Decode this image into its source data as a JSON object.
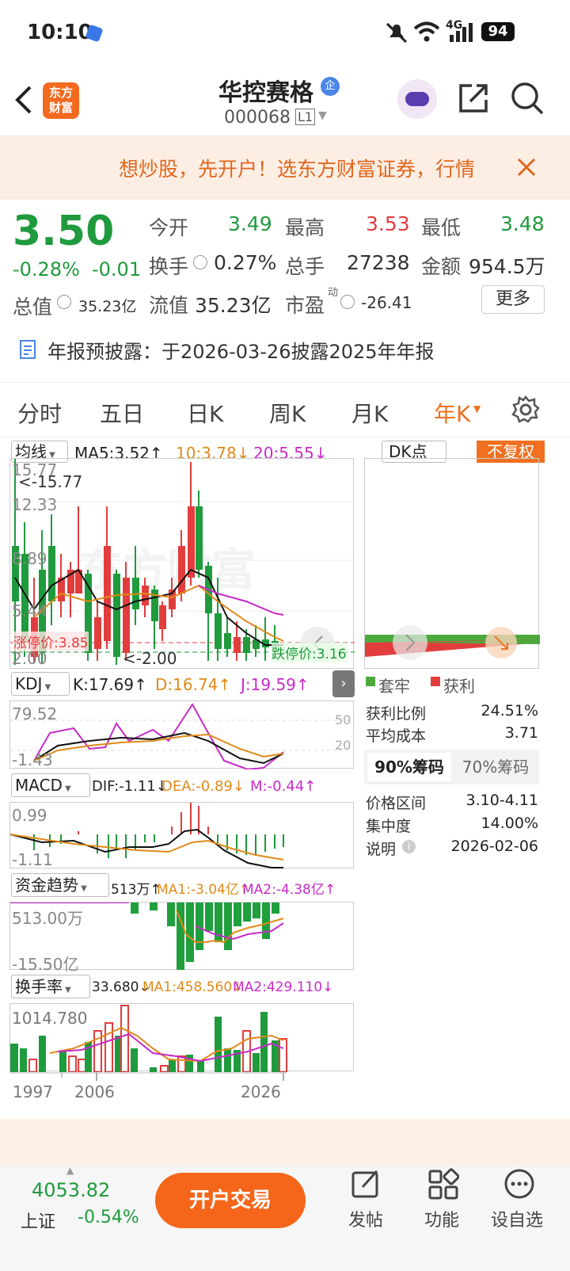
{
  "status": {
    "time": "10:10",
    "battery": "94",
    "net": "4G"
  },
  "nav": {
    "title": "华控赛格",
    "badge": "企",
    "code": "000068",
    "level": "L1",
    "brand": "东方\n财富"
  },
  "banner": {
    "text": "想炒股，先开户！选东方财富证券，行情"
  },
  "quote": {
    "price": "3.50",
    "pct": "-0.28%",
    "chg": "-0.01",
    "open_lbl": "今开",
    "open": "3.49",
    "high_lbl": "最高",
    "high": "3.53",
    "low_lbl": "最低",
    "low": "3.48",
    "turn_lbl": "换手",
    "turn": "0.27%",
    "vol_lbl": "总手",
    "vol": "27238",
    "amt_lbl": "金额",
    "amt": "954.5万",
    "mcap_lbl": "总值",
    "mcap": "35.23亿",
    "float_lbl": "流值",
    "float": "35.23亿",
    "pe_lbl": "市盈",
    "pe_sup": "动",
    "pe": "-26.41",
    "more": "更多"
  },
  "notice": {
    "text": "年报预披露：于2026-03-26披露2025年年报"
  },
  "tabs": [
    "分时",
    "五日",
    "日K",
    "周K",
    "月K",
    "年K"
  ],
  "main": {
    "ma_label": "均线",
    "ma5": "MA5:3.52↑",
    "ma10": "10:3.78↓",
    "ma20": "20:5.55↓",
    "dk": "DK点",
    "fq": "不复权",
    "y1": "15.77",
    "y2": "12.33",
    "y3": "8.89",
    "y4": "5.44",
    "y5": "2.00",
    "maxmark": "<-15.77",
    "minmark": "<-2.00",
    "limit_up": "涨停价:3.85",
    "limit_down": "跌停价:3.16"
  },
  "kdj": {
    "label": "KDJ",
    "k": "K:17.69↑",
    "d": "D:16.74↑",
    "j": "J:19.59↑",
    "y1": "79.52",
    "y2": "-1.43",
    "l50": "50",
    "l20": "20"
  },
  "macd": {
    "label": "MACD",
    "dif": "DIF:-1.11↓",
    "dea": "DEA:-0.89↓",
    "m": "M:-0.44↑",
    "y1": "0.99",
    "y2": "-1.11"
  },
  "fund": {
    "label": "资金趋势",
    "v": "513万↑",
    "ma1": "MA1:-3.04亿↑",
    "ma2": "MA2:-4.38亿↑",
    "y1": "513.00万",
    "y2": "-15.50亿"
  },
  "turnover": {
    "label": "换手率",
    "v": "33.680↓",
    "ma1": "MA1:458.560↓",
    "ma2": "MA2:429.110↓",
    "y1": "1014.780"
  },
  "xaxis": [
    "1997",
    "2006",
    "2026"
  ],
  "chip": {
    "legend_trap": "套牢",
    "legend_profit": "获利",
    "rows": [
      {
        "k": "获利比例",
        "v": "24.51%"
      },
      {
        "k": "平均成本",
        "v": "3.71"
      }
    ],
    "tab1": "90%筹码",
    "tab2": "70%筹码",
    "rows2": [
      {
        "k": "价格区间",
        "v": "3.10-4.11"
      },
      {
        "k": "集中度",
        "v": "14.00%"
      },
      {
        "k": "说明",
        "v": "2026-02-06"
      }
    ]
  },
  "bottom": {
    "index_val": "4053.82",
    "index_name": "上证",
    "index_pct": "-0.54%",
    "trade": "开户交易",
    "post": "发帖",
    "func": "功能",
    "watch": "设自选"
  }
}
